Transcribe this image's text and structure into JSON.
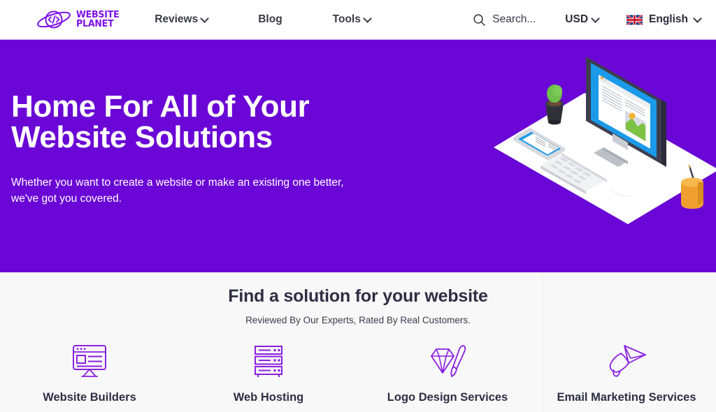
{
  "header": {
    "logo": {
      "icon": "planet-code-logo-icon",
      "line1": "WEBSITE",
      "line2": "PLANET",
      "code_glyph": "</>",
      "color": "#7d12e8"
    },
    "nav": [
      {
        "label": "Reviews",
        "has_caret": true
      },
      {
        "label": "Blog",
        "has_caret": false
      },
      {
        "label": "Tools",
        "has_caret": true
      }
    ],
    "search": {
      "icon": "search-icon",
      "placeholder": "Search...",
      "value": ""
    },
    "currency": {
      "label": "USD",
      "has_caret": true
    },
    "language": {
      "label": "English",
      "has_caret": true,
      "flag": "uk-flag-icon"
    }
  },
  "hero": {
    "title_line1": "Home For All of Your",
    "title_line2": "Website Solutions",
    "subtitle": "Whether you want to create a website or make an existing one better, we've got you covered.",
    "background_color": "#6a06d6",
    "illustration": "isometric-desk-workspace-illustration"
  },
  "solutions": {
    "title": "Find a solution for your website",
    "subtitle": "Reviewed By Our Experts, Rated By Real Customers.",
    "background_color": "#f8f8f9",
    "accent_color": "#7d12e8",
    "cards": [
      {
        "label": "Website Builders",
        "icon": "browser-window-monitor-icon"
      },
      {
        "label": "Web Hosting",
        "icon": "server-rack-icon"
      },
      {
        "label": "Logo Design Services",
        "icon": "diamond-paintbrush-icon"
      },
      {
        "label": "Email Marketing Services",
        "icon": "megaphone-paper-plane-icon"
      }
    ]
  }
}
